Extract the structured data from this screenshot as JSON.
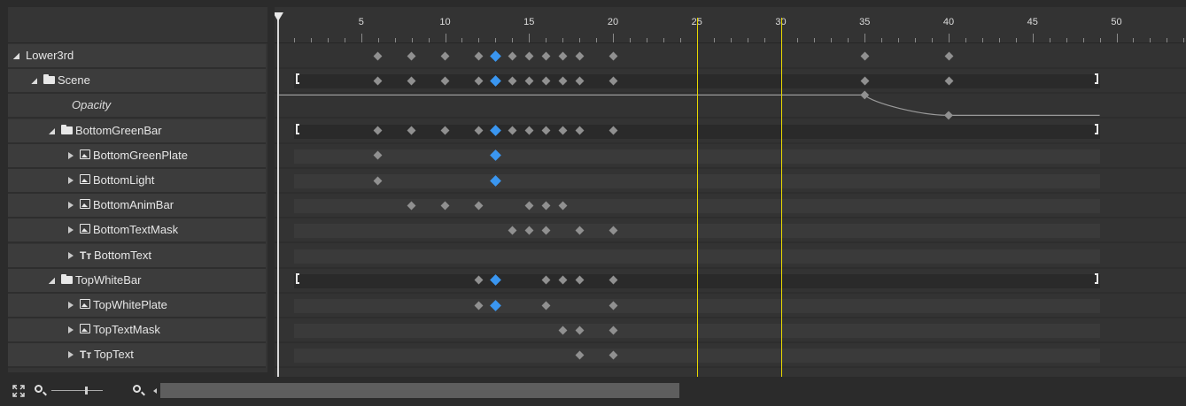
{
  "tree": {
    "rows": [
      {
        "label": "Lower3rd",
        "icon": "none",
        "expand": "open",
        "indent": 0,
        "kind": "root"
      },
      {
        "label": "Scene",
        "icon": "folder-icon",
        "expand": "open",
        "indent": 1,
        "kind": "group"
      },
      {
        "label": "Opacity",
        "icon": "none",
        "expand": "none",
        "indent": 2,
        "kind": "property"
      },
      {
        "label": "BottomGreenBar",
        "icon": "folder-icon",
        "expand": "open",
        "indent": 2,
        "kind": "group"
      },
      {
        "label": "BottomGreenPlate",
        "icon": "image-icon",
        "expand": "closed",
        "indent": 3,
        "kind": "layer"
      },
      {
        "label": "BottomLight",
        "icon": "image-icon",
        "expand": "closed",
        "indent": 3,
        "kind": "layer"
      },
      {
        "label": "BottomAnimBar",
        "icon": "image-icon",
        "expand": "closed",
        "indent": 3,
        "kind": "layer"
      },
      {
        "label": "BottomTextMask",
        "icon": "image-icon",
        "expand": "closed",
        "indent": 3,
        "kind": "layer"
      },
      {
        "label": "BottomText",
        "icon": "text-icon",
        "expand": "closed",
        "indent": 3,
        "kind": "layer"
      },
      {
        "label": "TopWhiteBar",
        "icon": "folder-icon",
        "expand": "open",
        "indent": 2,
        "kind": "group"
      },
      {
        "label": "TopWhitePlate",
        "icon": "image-icon",
        "expand": "closed",
        "indent": 3,
        "kind": "layer"
      },
      {
        "label": "TopTextMask",
        "icon": "image-icon",
        "expand": "closed",
        "indent": 3,
        "kind": "layer"
      },
      {
        "label": "TopText",
        "icon": "text-icon",
        "expand": "closed",
        "indent": 3,
        "kind": "layer"
      }
    ]
  },
  "timeline": {
    "ruler_labels": [
      "5",
      "10",
      "15",
      "20",
      "25",
      "30",
      "35",
      "40",
      "45",
      "50"
    ],
    "ruler_values": [
      5,
      10,
      15,
      20,
      25,
      30,
      35,
      40,
      45,
      50
    ],
    "range_start": 0,
    "range_end": 49,
    "playhead_frame": 0,
    "markers": [
      25,
      30
    ],
    "selected_frame": 13,
    "rows": [
      {
        "track": "none",
        "keyframes": [
          6,
          8,
          10,
          12,
          13,
          14,
          15,
          16,
          17,
          18,
          20,
          35,
          40
        ]
      },
      {
        "track": "group",
        "keyframes": [
          6,
          8,
          10,
          12,
          13,
          14,
          15,
          16,
          17,
          18,
          20,
          35,
          40
        ]
      },
      {
        "track": "curve",
        "keyframes": [
          35,
          40
        ],
        "curve": [
          [
            0,
            1.0
          ],
          [
            35,
            1.0
          ],
          [
            40,
            0.0
          ],
          [
            49,
            0.0
          ]
        ]
      },
      {
        "track": "group",
        "keyframes": [
          6,
          8,
          10,
          12,
          13,
          14,
          15,
          16,
          17,
          18,
          20
        ]
      },
      {
        "track": "layer",
        "keyframes": [
          6,
          13
        ]
      },
      {
        "track": "layer",
        "keyframes": [
          6,
          13
        ]
      },
      {
        "track": "layer",
        "keyframes": [
          8,
          10,
          12,
          15,
          16,
          17
        ]
      },
      {
        "track": "layer",
        "keyframes": [
          14,
          15,
          16,
          18,
          20
        ]
      },
      {
        "track": "layer",
        "keyframes": []
      },
      {
        "track": "group",
        "keyframes": [
          12,
          13,
          16,
          17,
          18,
          20
        ]
      },
      {
        "track": "layer",
        "keyframes": [
          12,
          13,
          16,
          20
        ]
      },
      {
        "track": "layer",
        "keyframes": [
          17,
          18,
          20
        ]
      },
      {
        "track": "layer",
        "keyframes": [
          18,
          20
        ]
      }
    ]
  },
  "bottom_bar": {
    "zoom_level": 0.66,
    "scroll_fraction": 0.56
  },
  "colors": {
    "selected_keyframe": "#3a96f0",
    "keyframe": "#909090",
    "marker": "#e8d800"
  }
}
